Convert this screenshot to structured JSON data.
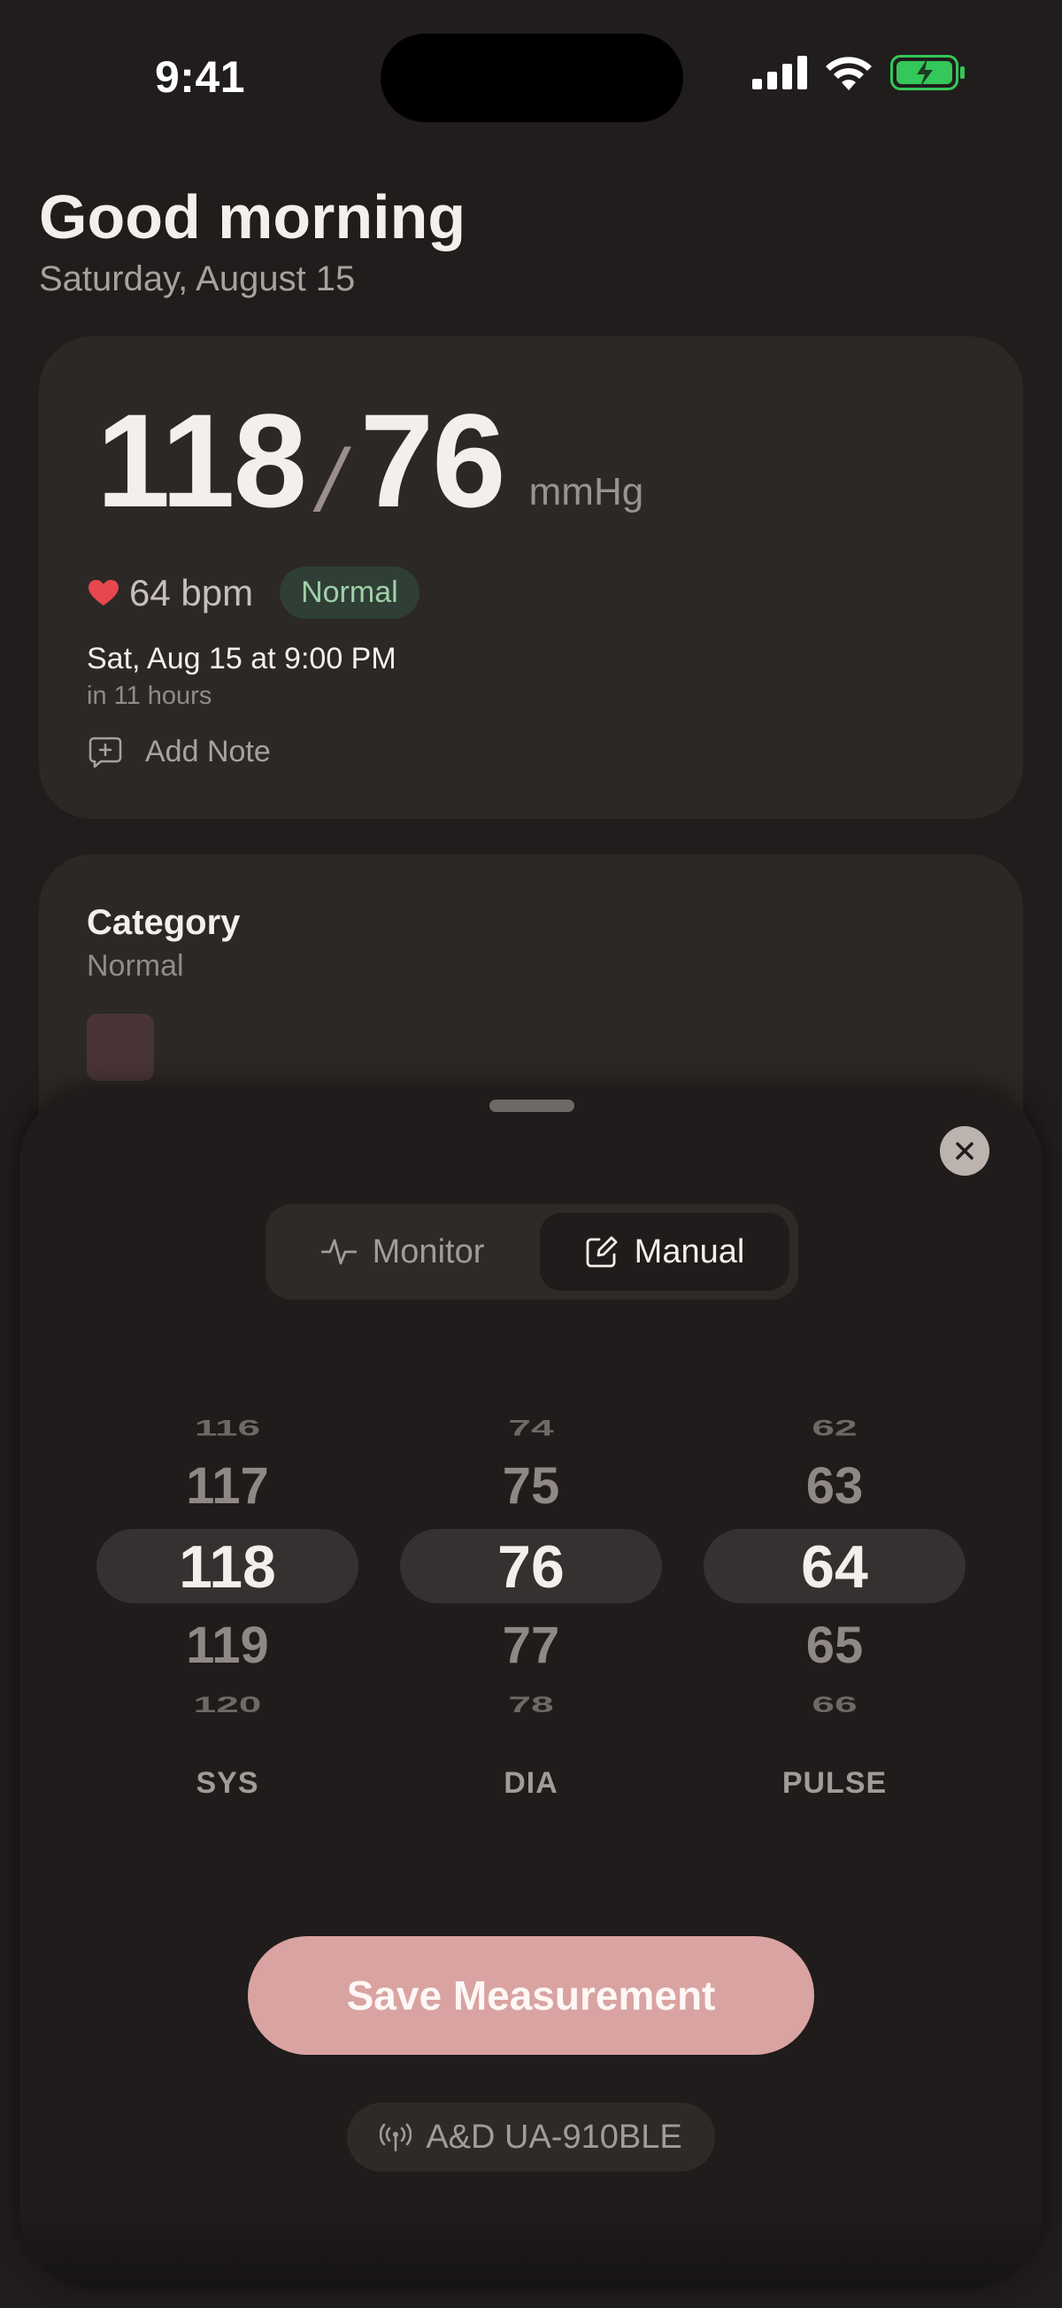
{
  "status_bar": {
    "time": "9:41",
    "icons": [
      "signal-icon",
      "wifi-icon",
      "battery-charging-icon"
    ],
    "battery_color": "#34c759"
  },
  "header": {
    "greeting": "Good morning",
    "date": "Saturday, August 15"
  },
  "reading": {
    "systolic": "118",
    "slash": "/",
    "diastolic": "76",
    "unit": "mmHg",
    "pulse": "64 bpm",
    "status_badge": "Normal",
    "scheduled": "Sat, Aug 15 at 9:00 PM",
    "relative": "in 11 hours",
    "add_note_label": "Add Note"
  },
  "category": {
    "title": "Category",
    "value": "Normal",
    "swatch_color": "#4a3536"
  },
  "sheet": {
    "segments": [
      {
        "label": "Monitor",
        "icon": "waveform-icon",
        "selected": false
      },
      {
        "label": "Manual",
        "icon": "edit-icon",
        "selected": true
      }
    ],
    "pickers": [
      {
        "label": "SYS",
        "values": [
          "116",
          "117",
          "118",
          "119",
          "120"
        ],
        "selected": "118"
      },
      {
        "label": "DIA",
        "values": [
          "74",
          "75",
          "76",
          "77",
          "78"
        ],
        "selected": "76"
      },
      {
        "label": "PULSE",
        "values": [
          "62",
          "63",
          "64",
          "65",
          "66"
        ],
        "selected": "64"
      }
    ],
    "save_label": "Save Measurement",
    "device_label": "A&D UA-910BLE"
  },
  "colors": {
    "accent": "#d9a3a1",
    "heart": "#e5484d",
    "normal_badge_text": "#9fd0a9",
    "background": "#201d1c"
  }
}
